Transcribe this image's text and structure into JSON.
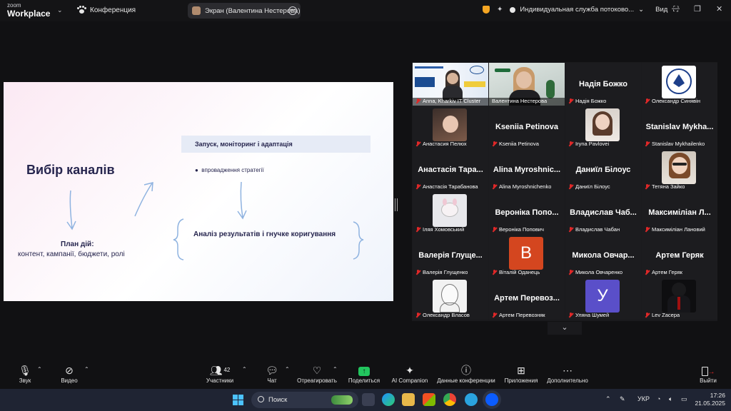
{
  "topbar": {
    "brand_top": "zoom",
    "brand_bottom": "Workplace",
    "meeting_label": "Конференция",
    "share_label": "Экран (Валентина Нестерова)",
    "stream_label": "Индивидуальная служба потоково...",
    "view_label": "Вид"
  },
  "slide": {
    "title": "Вибір каналів",
    "box_label": "Запуск, моніторинг і адаптація",
    "bullet": "впровадження стратегії",
    "plan_title": "План дій:",
    "plan_sub": "контент, кампанії, бюджети, ролі",
    "analysis": "Аналіз результатів і гнучке коригування"
  },
  "gallery": {
    "tiles": [
      {
        "label": "Anna, Kharkiv IT Cluster",
        "big": ""
      },
      {
        "label": "Валентина Нестерова",
        "big": ""
      },
      {
        "label": "Надія Божко",
        "big": "Надія Божко"
      },
      {
        "label": "Олександр Синявін",
        "big": ""
      },
      {
        "label": "Анастасия Пелюх",
        "big": ""
      },
      {
        "label": "Kseniia Petinova",
        "big": "Kseniia Petinova"
      },
      {
        "label": "Iryna Pavlovei",
        "big": ""
      },
      {
        "label": "Stanislav Mykhailenko",
        "big": "Stanislav Mykha..."
      },
      {
        "label": "Анастасія Тарабанова",
        "big": "Анастасія Тара..."
      },
      {
        "label": "Alina Myroshnichenko",
        "big": "Alina Myroshnic..."
      },
      {
        "label": "Даниїл Білоус",
        "big": "Даниїл Білоус"
      },
      {
        "label": "Тетяна Зайко",
        "big": ""
      },
      {
        "label": "Іляя Хомовський",
        "big": ""
      },
      {
        "label": "Вероніка Попович",
        "big": "Вероніка Попо..."
      },
      {
        "label": "Владислав Чабан",
        "big": "Владислав Чаб..."
      },
      {
        "label": "Максиміліан Лановий",
        "big": "Максиміліан Л..."
      },
      {
        "label": "Валерія Глущенко",
        "big": "Валерія Глуще..."
      },
      {
        "label": "Віталій Оданець",
        "big": ""
      },
      {
        "label": "Микола Овчаренко",
        "big": "Микола Овчар..."
      },
      {
        "label": "Артем Геряк",
        "big": "Артем Геряк"
      },
      {
        "label": "Олександр Власов",
        "big": ""
      },
      {
        "label": "Артем Перевозняк",
        "big": "Артем Перевоз..."
      },
      {
        "label": "Уляна Шумей",
        "big": ""
      },
      {
        "label": "Lev Zacepa",
        "big": ""
      }
    ],
    "letter_b": "В",
    "letter_u": "У"
  },
  "toolbar": {
    "sound": "Звук",
    "video": "Видео",
    "participants": "Участники",
    "participants_count": "42",
    "chat": "Чат",
    "react": "Отреагировать",
    "share": "Поделиться",
    "ai": "AI Companion",
    "conf_data": "Данные конференции",
    "apps": "Приложения",
    "more": "Дополнительно",
    "leave": "Выйти"
  },
  "taskbar": {
    "search": "Поиск",
    "lang": "УКР",
    "time": "17:26",
    "date": "21.05.2025"
  },
  "colors": {
    "accent_green": "#36b34d",
    "mute_red": "#e02828",
    "slide_text": "#26254e"
  }
}
